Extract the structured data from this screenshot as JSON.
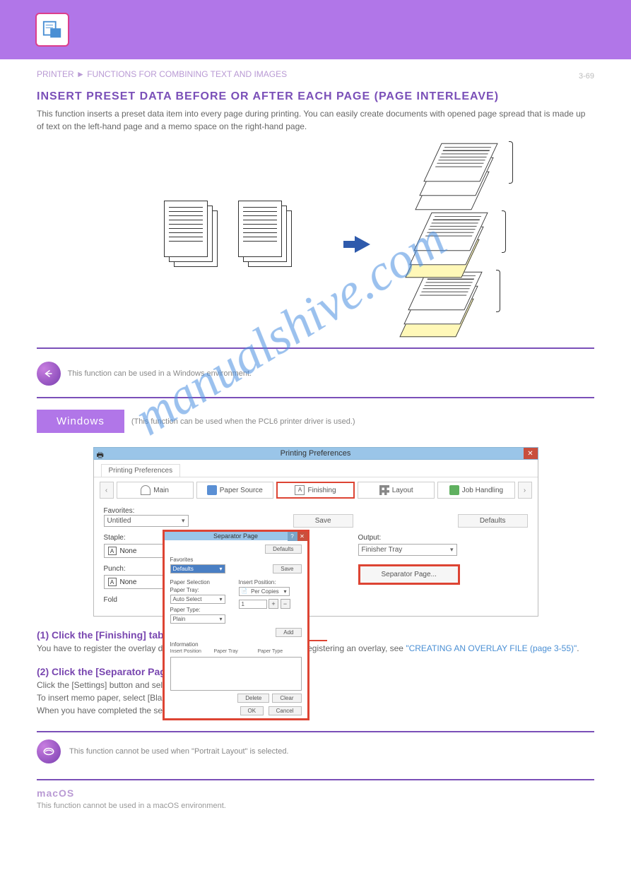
{
  "topbar": {
    "breadcrumb_left": "PRINTER",
    "breadcrumb_right": "► FUNCTIONS FOR COMBINING TEXT AND IMAGES",
    "page_number": "3-69"
  },
  "section": {
    "title": "INSERT PRESET DATA BEFORE OR AFTER EACH PAGE (PAGE INTERLEAVE)",
    "intro": "This function inserts a preset data item into every page during printing. You can easily create documents with opened page spread that is made up of text on the left-hand page and a memo space on the right-hand page."
  },
  "back_link": "This function can be used in a Windows environment.",
  "windows": {
    "badge": "Windows",
    "note": "(This function can be used when the PCL6 printer driver is used.)"
  },
  "dialog": {
    "title": "Printing Preferences",
    "tab_label": "Printing Preferences",
    "tabs": {
      "main": "Main",
      "paper_source": "Paper Source",
      "finishing": "Finishing",
      "layout": "Layout",
      "job_handling": "Job Handling"
    },
    "favorites_label": "Favorites:",
    "favorites_value": "Untitled",
    "save_btn": "Save",
    "defaults_btn": "Defaults",
    "left_col": {
      "staple_label": "Staple:",
      "staple_value": "None",
      "punch_label": "Punch:",
      "punch_value": "None",
      "fold_label": "Fold"
    },
    "right_col": {
      "output_label": "Output:",
      "output_value": "Finisher Tray",
      "separator_btn": "Separator Page..."
    }
  },
  "sub_dialog": {
    "title": "Separator Page",
    "defaults_btn": "Defaults",
    "favorites_label": "Favorites",
    "favorites_value": "Defaults",
    "save_btn": "Save",
    "paper_sel_label": "Paper Selection",
    "paper_tray_label": "Paper Tray:",
    "paper_tray_value": "Auto Select",
    "paper_type_label": "Paper Type:",
    "paper_type_value": "Plain",
    "insert_pos_label": "Insert Position:",
    "insert_pos_value": "Per Copies",
    "count_value": "1",
    "add_btn": "Add",
    "info_label": "Information",
    "col1": "Insert Position",
    "col2": "Paper Tray",
    "col3": "Paper Type",
    "delete_btn": "Delete",
    "clear_btn": "Clear",
    "ok_btn": "OK",
    "cancel_btn": "Cancel"
  },
  "steps": {
    "step1_title": "(1) Click the [Finishing] tab.",
    "step1_text": "You have to register the overlay data in advance. For the procedure for registering an overlay, see",
    "step1_link": "\"CREATING AN OVERLAY FILE (page 3-55)\"",
    "step2_title": "(2) Click the [Separator Page] button.",
    "step2_text1": "Click the [Settings] button and select the page interleave settings.",
    "step2_text2": "To insert memo paper, select [Blank Sheet] option.",
    "step2_text3": "When you have completed the settings, click the [OK] button."
  },
  "note": "This function cannot be used when \"Portrait Layout\" is selected.",
  "mac": {
    "head": "macOS",
    "note": "This function cannot be used in a macOS environment."
  },
  "watermark": "manualshive.com"
}
